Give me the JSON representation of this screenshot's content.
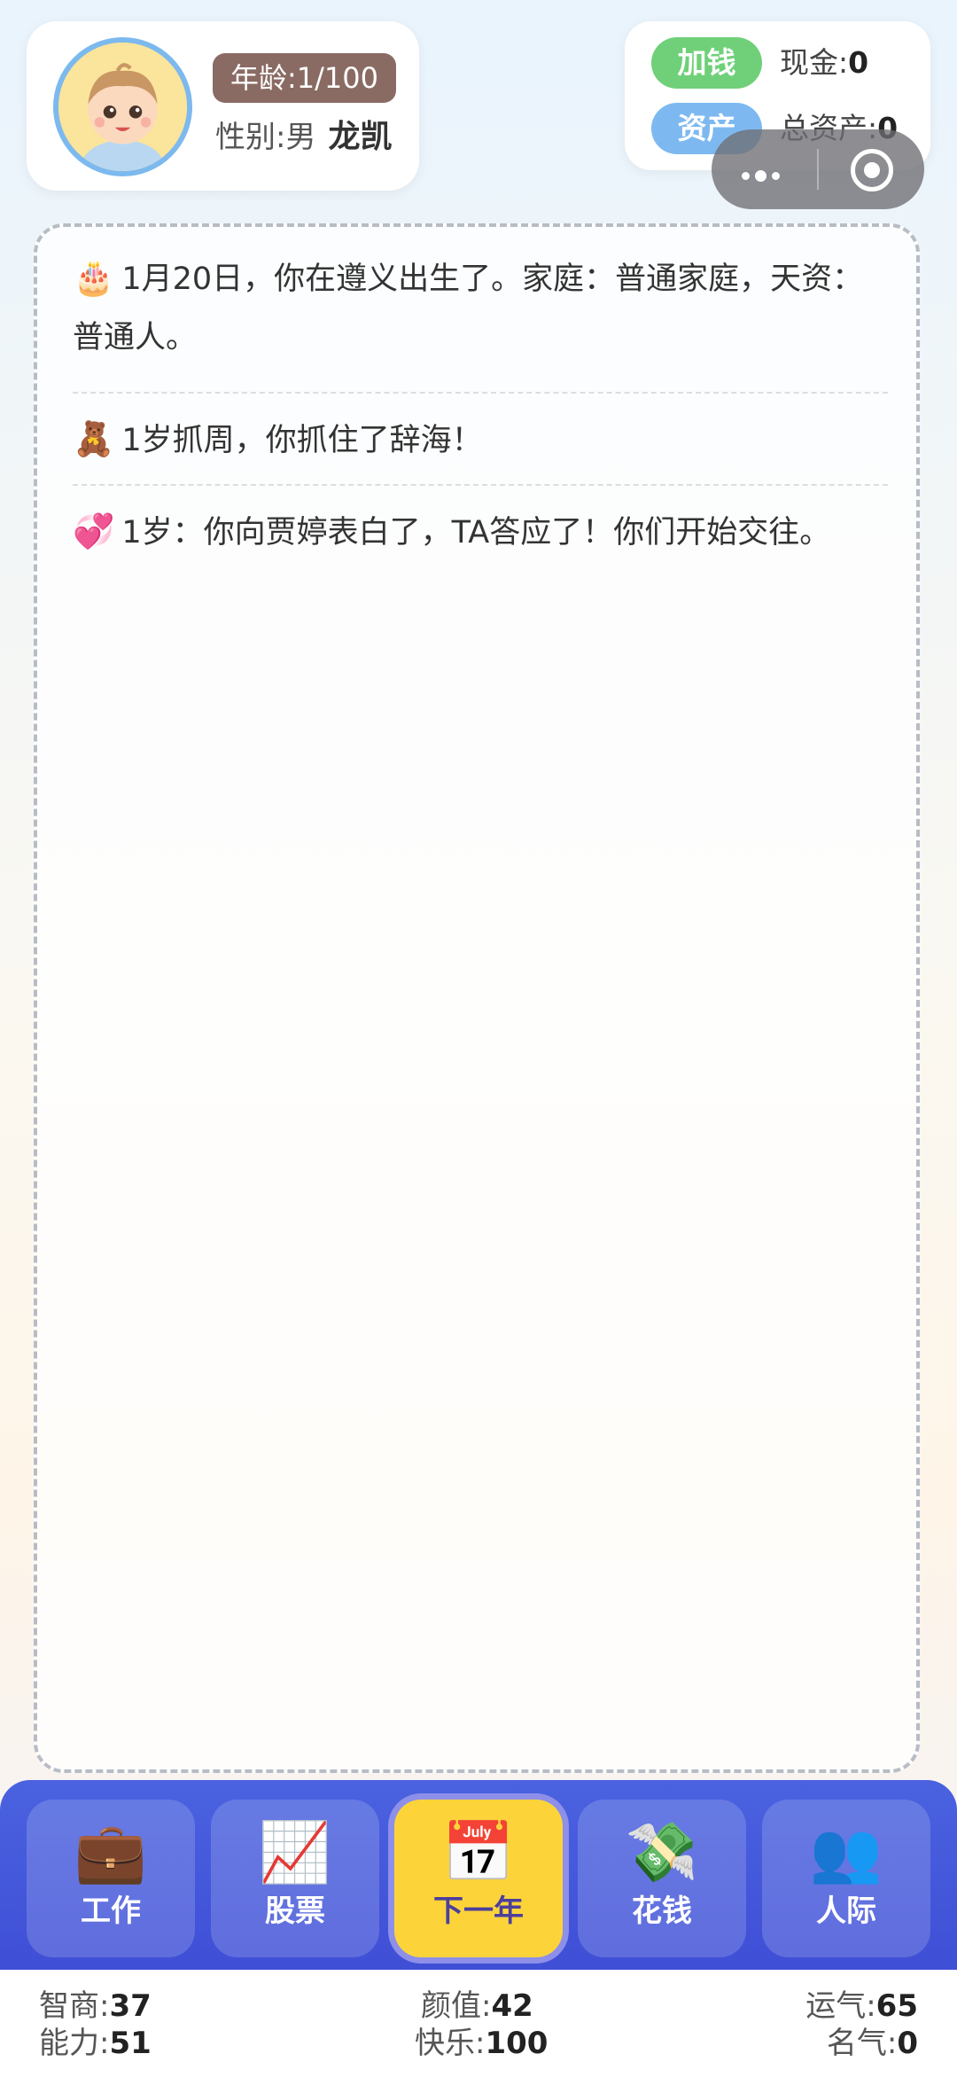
{
  "profile": {
    "age_badge": "年龄:1/100",
    "gender_label": "性别:男",
    "name": "龙凯"
  },
  "money": {
    "add_label": "加钱",
    "assets_label": "资产",
    "cash_label": "现金:",
    "cash_value": "0",
    "total_label": "总资产:",
    "total_value": "0"
  },
  "log": [
    {
      "icon": "🎂",
      "text": "1月20日，你在遵义出生了。家庭：普通家庭，天资：普通人。"
    },
    {
      "icon": "🧸",
      "text": "1岁抓周，你抓住了辞海！"
    },
    {
      "icon": "💞",
      "text": "1岁：你向贾婷表白了，TA答应了！你们开始交往。"
    }
  ],
  "nav": [
    {
      "label": "工作",
      "icon": "briefcase-icon",
      "glyph": "💼"
    },
    {
      "label": "股票",
      "icon": "chart-up-icon",
      "glyph": "📈"
    },
    {
      "label": "下一年",
      "icon": "calendar-icon",
      "glyph": "📅",
      "active": true
    },
    {
      "label": "花钱",
      "icon": "money-wings-icon",
      "glyph": "💸"
    },
    {
      "label": "人际",
      "icon": "people-icon",
      "glyph": "👥"
    }
  ],
  "stats": {
    "iq_label": "智商:",
    "iq": "37",
    "ability_label": "能力:",
    "ability": "51",
    "looks_label": "颜值:",
    "looks": "42",
    "happiness_label": "快乐:",
    "happiness": "100",
    "luck_label": "运气:",
    "luck": "65",
    "fame_label": "名气:",
    "fame": "0"
  },
  "colors": {
    "accent_blue": "#4a62e0",
    "active_yellow": "#fcd43a",
    "add_green": "#6fd079",
    "assets_blue": "#7db9f0",
    "age_brown": "#8a6b63"
  }
}
